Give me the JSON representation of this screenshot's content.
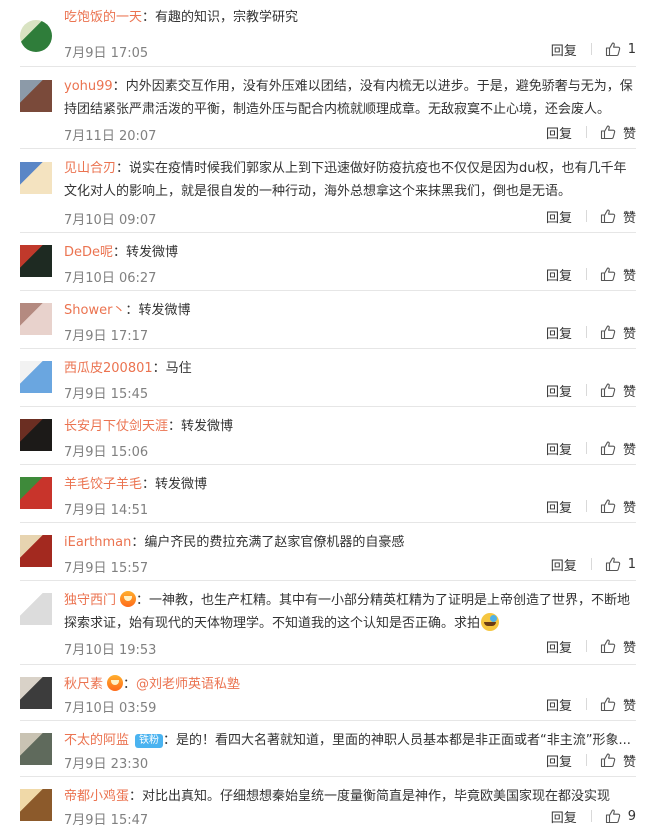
{
  "labels": {
    "reply": "回复",
    "like": "赞"
  },
  "comments": [
    {
      "user": "吃饱饭的一天",
      "text": "有趣的知识，宗教学研究",
      "date": "7月9日 17:05",
      "like_count": "1",
      "avatar_colors": [
        "#2f7d3a",
        "#d9e3c2"
      ]
    },
    {
      "user": "yohu99",
      "text": "内外因素交互作用，没有外压难以团结，没有内梳无以进步。于是，避免骄奢与无为，保持团结紧张严肃活泼的平衡，制造外压与配合内梳就顺理成章。无敌寂寞不止心境，还会废人。",
      "date": "7月11日 20:07",
      "like_count": "赞",
      "avatar_colors": [
        "#7a4a3a",
        "#8c9aa8"
      ]
    },
    {
      "user": "见山合刃",
      "text": "说实在疫情时候我们郭家从上到下迅速做好防疫抗疫也不仅仅是因为du权，也有几千年文化对人的影响上，就是很自发的一种行动，海外总想拿这个来抹黑我们，倒也是无语。",
      "date": "7月10日 09:07",
      "like_count": "赞",
      "avatar_colors": [
        "#f4e3c0",
        "#5a86c6"
      ]
    },
    {
      "user": "DeDe呢",
      "text": "转发微博",
      "date": "7月10日 06:27",
      "like_count": "赞",
      "avatar_colors": [
        "#1e2a22",
        "#c0392b"
      ]
    },
    {
      "user": "Shower丶",
      "text": "转发微博",
      "date": "7月9日 17:17",
      "like_count": "赞",
      "avatar_colors": [
        "#e8d2cc",
        "#b48a80"
      ]
    },
    {
      "user": "西瓜皮200801",
      "text": "马住",
      "date": "7月9日 15:45",
      "like_count": "赞",
      "avatar_colors": [
        "#6aa6e0",
        "#f2f2f2"
      ]
    },
    {
      "user": "长安月下仗剑天涯",
      "text": "转发微博",
      "date": "7月9日 15:06",
      "like_count": "赞",
      "avatar_colors": [
        "#1c1a18",
        "#6b2e22"
      ]
    },
    {
      "user": "羊毛饺子羊毛",
      "text": "转发微博",
      "date": "7月9日 14:51",
      "like_count": "赞",
      "avatar_colors": [
        "#c8342b",
        "#3e8a3a"
      ]
    },
    {
      "user": "iEarthman",
      "text": "编户齐民的费拉充满了赵家官僚机器的自豪感",
      "date": "7月9日 15:57",
      "like_count": "1",
      "avatar_colors": [
        "#a3291f",
        "#e7d4b0"
      ]
    },
    {
      "user": "独守西门",
      "text": "一神教，也生产杠精。其中有一小部分精英杠精为了证明是上帝创造了世界，不断地探索求证，始有现代的天体物理学。不知道我的这个认知是否正确。求拍",
      "date": "7月10日 19:53",
      "like_count": "赞",
      "avatar_colors": [
        "#dcdcdc",
        "#ffffff"
      ],
      "vip": true,
      "emoji_end": true
    },
    {
      "user": "秋尺素",
      "text": "@刘老师英语私塾",
      "date": "7月10日 03:59",
      "like_count": "赞",
      "avatar_colors": [
        "#3c3c3c",
        "#d9d2c8"
      ],
      "vip": true,
      "text_is_mention": true
    },
    {
      "user": "不太的阿监",
      "badge": "铁粉",
      "text": "是的！看四大名著就知道，里面的神职人员基本都是非正面或者“非主流”形象...",
      "date": "7月9日 23:30",
      "like_count": "赞",
      "avatar_colors": [
        "#5f6a5c",
        "#c9c3b3"
      ]
    },
    {
      "user": "帝都小鸡蛋",
      "text": "对比出真知。仔细想想秦始皇统一度量衡简直是神作，毕竟欧美国家现在都没实现",
      "date": "7月9日 15:47",
      "like_count": "9",
      "avatar_colors": [
        "#8c5a2b",
        "#f0d9a8"
      ]
    }
  ]
}
